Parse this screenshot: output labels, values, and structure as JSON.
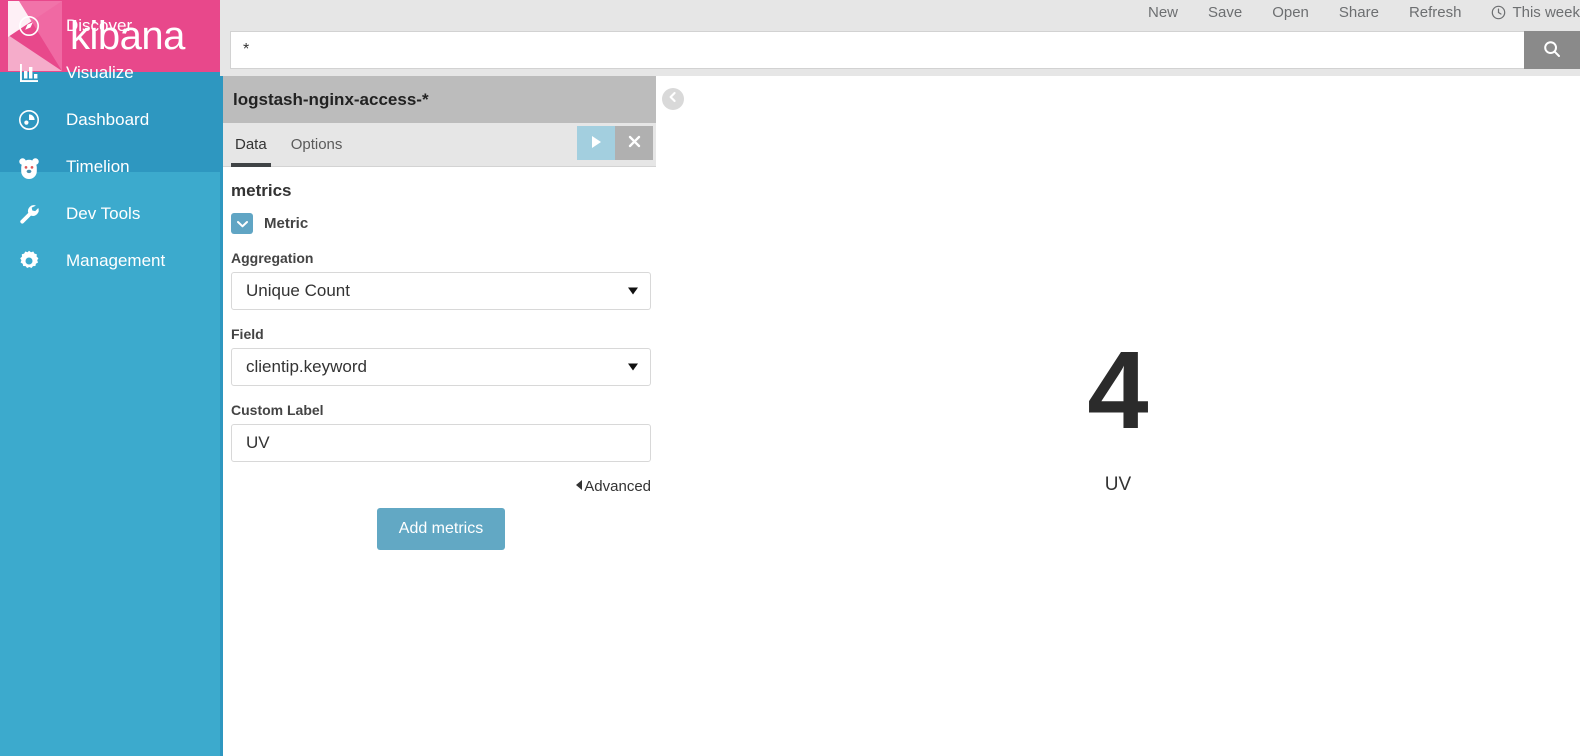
{
  "brand": {
    "name": "kibana",
    "logo_icon": "kibana-logo-icon",
    "accent_pink": "#e8488b",
    "sidebar_blue": "#3caacd",
    "sidebar_blue_active": "#2e97c0"
  },
  "sidebar": {
    "items": [
      {
        "label": "Discover",
        "icon": "compass-icon",
        "active": true
      },
      {
        "label": "Visualize",
        "icon": "bar-chart-icon",
        "active": true
      },
      {
        "label": "Dashboard",
        "icon": "dashboard-icon",
        "active": false
      },
      {
        "label": "Timelion",
        "icon": "bear-icon",
        "active": false
      },
      {
        "label": "Dev Tools",
        "icon": "wrench-icon",
        "active": false
      },
      {
        "label": "Management",
        "icon": "gear-icon",
        "active": false
      }
    ]
  },
  "topnav": {
    "items": [
      {
        "label": "New"
      },
      {
        "label": "Save"
      },
      {
        "label": "Open"
      },
      {
        "label": "Share"
      },
      {
        "label": "Refresh"
      }
    ],
    "timepicker": {
      "label": "This week",
      "icon": "clock-icon"
    }
  },
  "query": {
    "value": "*",
    "placeholder": "",
    "submit_icon": "search-icon"
  },
  "config": {
    "index_pattern": "logstash-nginx-access-*",
    "tabs": [
      {
        "label": "Data",
        "active": true
      },
      {
        "label": "Options",
        "active": false
      }
    ],
    "apply_icon": "play-icon",
    "discard_icon": "close-icon",
    "metrics_section_title": "metrics",
    "metric_toggle": {
      "label": "Metric",
      "icon": "chevron-down-icon",
      "expanded": true
    },
    "aggregation": {
      "label": "Aggregation",
      "value": "Unique Count",
      "options": [
        "Unique Count"
      ]
    },
    "field": {
      "label": "Field",
      "value": "clientip.keyword",
      "options": [
        "clientip.keyword"
      ]
    },
    "custom_label": {
      "label": "Custom Label",
      "value": "UV",
      "placeholder": ""
    },
    "advanced_label": "Advanced",
    "add_metrics_label": "Add metrics"
  },
  "visualization": {
    "collapse_icon": "chevron-left-circle-icon",
    "metric_value": "4",
    "metric_caption": "UV"
  }
}
